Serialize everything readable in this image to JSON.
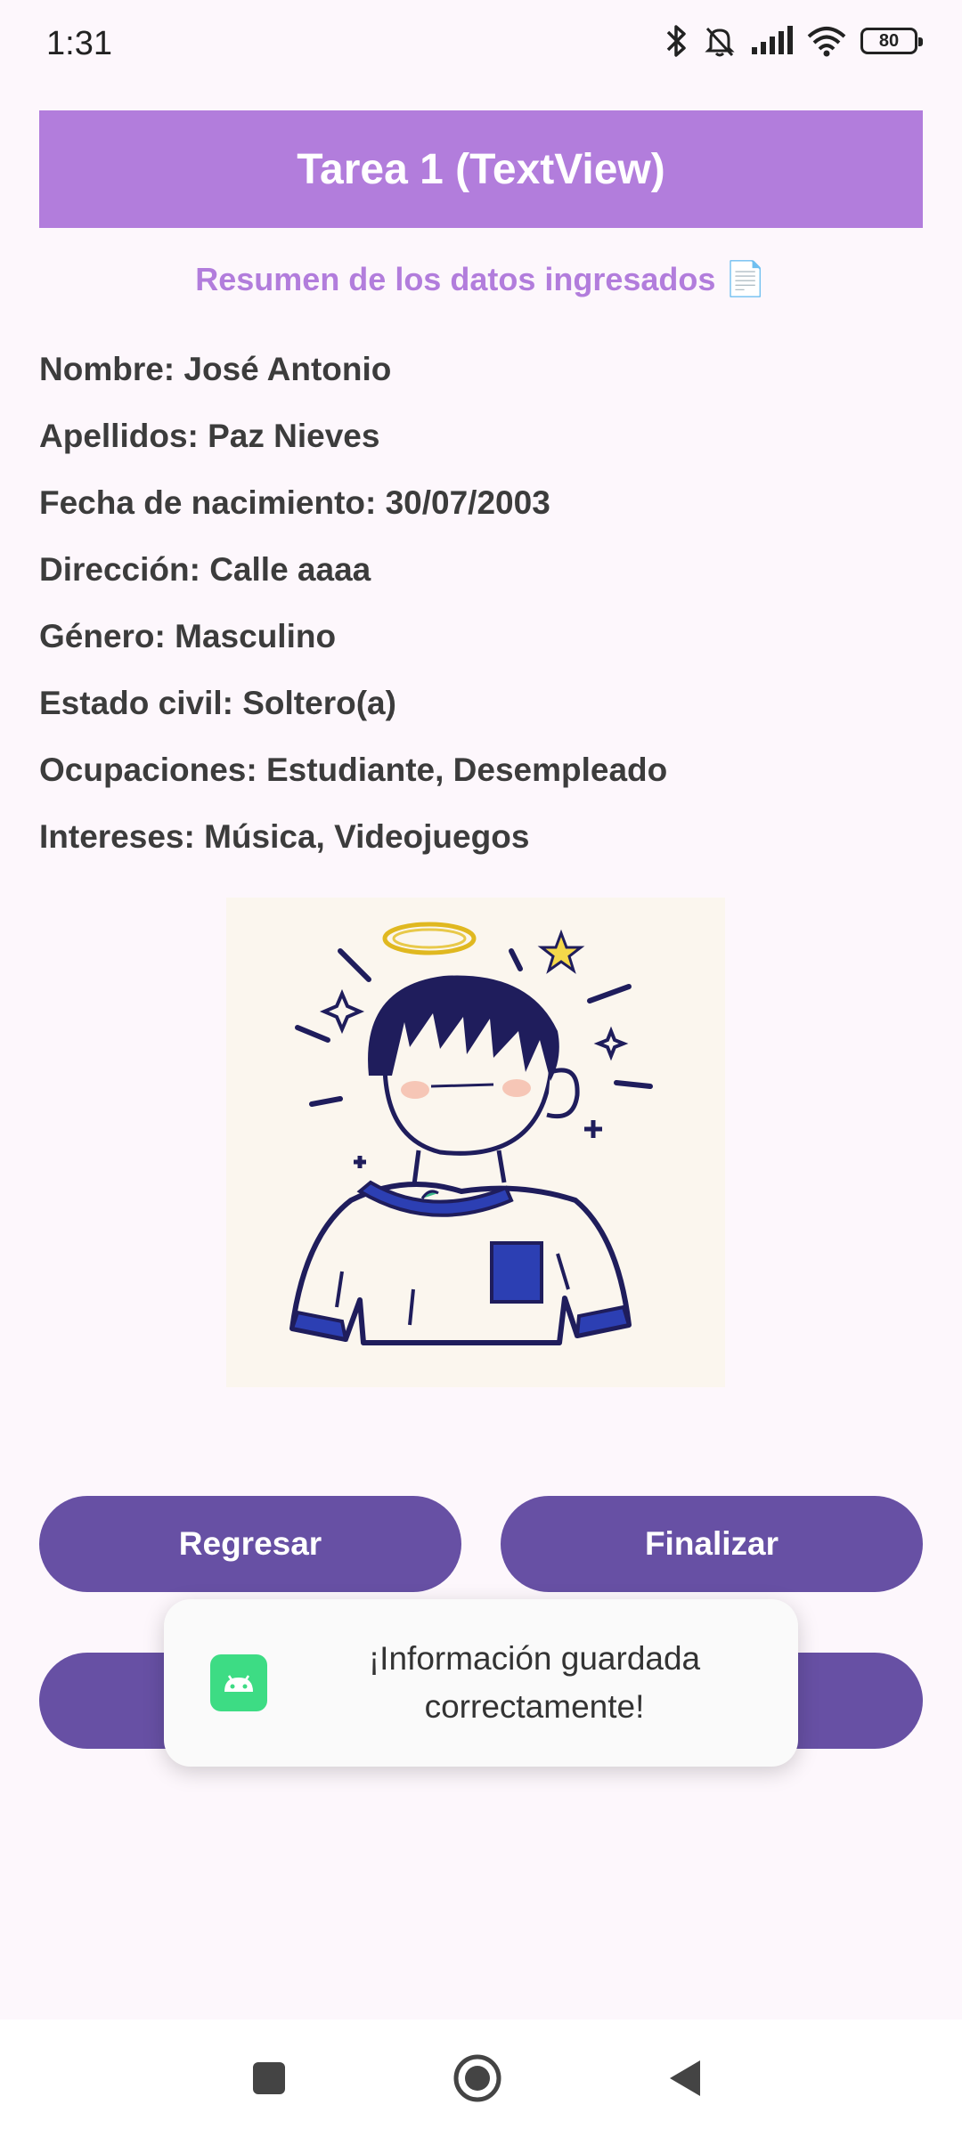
{
  "status_bar": {
    "time": "1:31",
    "battery": "80",
    "icons": [
      "bluetooth-icon",
      "bell-muted-icon",
      "signal-icon",
      "wifi-icon",
      "battery-icon"
    ]
  },
  "header": {
    "title": "Tarea 1 (TextView)",
    "color": "#b27ddc"
  },
  "summary": {
    "title": "Resumen de los datos ingresados",
    "emoji": "📄"
  },
  "fields": [
    "Nombre: José Antonio",
    "Apellidos: Paz Nieves",
    "Fecha de nacimiento: 30/07/2003",
    "Dirección: Calle aaaa",
    "Género: Masculino",
    "Estado civil: Soltero(a)",
    "Ocupaciones: Estudiante, Desempleado",
    "Intereses: Música, Videojuegos"
  ],
  "buttons": {
    "back": "Regresar",
    "finish": "Finalizar",
    "color": "#6750a4"
  },
  "toast": {
    "message": "¡Información guardada correctamente!",
    "icon": "android-app-icon"
  },
  "nav_bar": {
    "icons": [
      "recents-square-icon",
      "home-circle-icon",
      "back-triangle-icon"
    ]
  }
}
